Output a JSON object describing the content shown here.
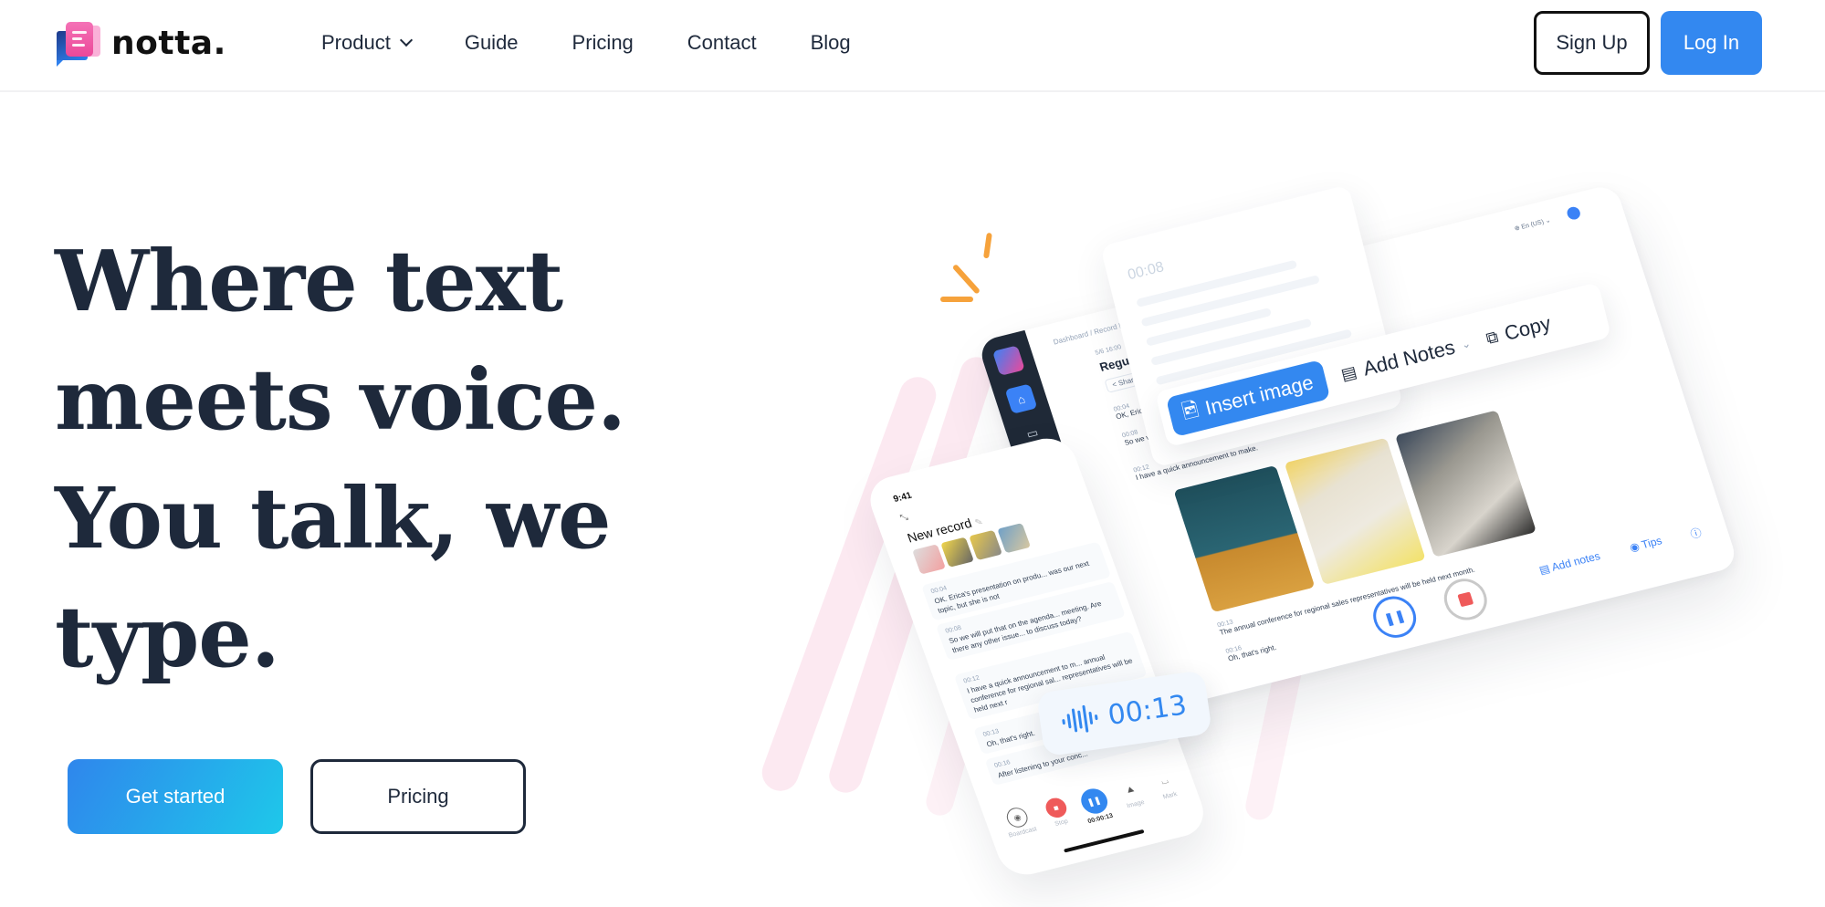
{
  "brand": {
    "name": "notta.",
    "logo_icon": "notta-logo-icon"
  },
  "nav": {
    "items": [
      {
        "label": "Product",
        "has_dropdown": true
      },
      {
        "label": "Guide"
      },
      {
        "label": "Pricing"
      },
      {
        "label": "Contact"
      },
      {
        "label": "Blog"
      }
    ],
    "signup_label": "Sign Up",
    "login_label": "Log In"
  },
  "hero": {
    "title_lines": [
      "Where text",
      "meets voice.",
      "You talk, we",
      "type."
    ],
    "primary_cta": "Get started",
    "secondary_cta": "Pricing"
  },
  "colors": {
    "accent": "#3388f0",
    "heading": "#1e293b",
    "cta_gradient_start": "#2f86ec",
    "cta_gradient_end": "#1ec8ea",
    "spark": "#f6a23b",
    "stop_red": "#ef5a5a"
  },
  "illustration": {
    "desktop": {
      "breadcrumb": "Dashboard / Record Detail",
      "date": "5/6 16:00",
      "record_title": "Regular M",
      "share_label": "Share",
      "language": "En (US)",
      "segments": [
        {
          "ts": "00:04",
          "text": "OK, Erica"
        },
        {
          "ts": "00:08",
          "text": "So we w... that we"
        },
        {
          "ts": "00:12",
          "text": "I have a quick announcement to make."
        },
        {
          "ts": "00:13",
          "text": "The annual conference for regional sales representatives will be held next month."
        },
        {
          "ts": "00:16",
          "text": "Oh, that's right."
        }
      ],
      "footer_links": [
        "Add notes",
        "Tips"
      ],
      "sidebar_icons": [
        "home-icon",
        "calendar-icon",
        "folder-icon",
        "document-icon",
        "trash-icon"
      ]
    },
    "note_card": {
      "time": "00:08"
    },
    "toolbar": {
      "insert_image": "Insert image",
      "add_notes": "Add Notes",
      "copy": "Copy"
    },
    "phone": {
      "clock": "9:41",
      "title": "New record",
      "segments": [
        {
          "ts": "00:04",
          "text": "OK. Erica's presentation on produ... was our next topic, but she is not"
        },
        {
          "ts": "00:08",
          "text": "So we will put that on the agenda... meeting. Are there any other issue... to discuss today?"
        },
        {
          "ts": "00:12",
          "text": "I have a quick announcement to m... annual conference for regional sal... representatives will be held next r"
        },
        {
          "ts": "00:13",
          "text": "Oh, that's right."
        },
        {
          "ts": "00:16",
          "text": "After listening to your conc..."
        }
      ],
      "controls": [
        {
          "label": "Boardcast"
        },
        {
          "label": "Stop"
        },
        {
          "label": "00:00:13"
        },
        {
          "label": "Image"
        },
        {
          "label": "Mark"
        }
      ]
    },
    "timer": {
      "value": "00:13"
    }
  }
}
